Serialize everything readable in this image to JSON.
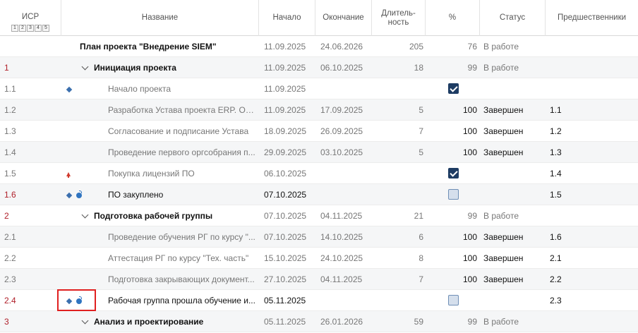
{
  "columns": {
    "wbs": "ИСР",
    "levels": [
      "1",
      "2",
      "3",
      "4",
      "5"
    ],
    "name": "Название",
    "start": "Начало",
    "end": "Окончание",
    "duration": "Длитель-\nность",
    "percent": "%",
    "status": "Статус",
    "predecessors": "Предшественники"
  },
  "rows": [
    {
      "wbs": "",
      "name": "План проекта \"Внедрение SIEM\"",
      "start": "11.09.2025",
      "end": "24.06.2026",
      "duration": "205",
      "percent": "76",
      "status": "В работе",
      "pred": ""
    },
    {
      "wbs": "1",
      "name": "Инициация проекта",
      "start": "11.09.2025",
      "end": "06.10.2025",
      "duration": "18",
      "percent": "99",
      "status": "В работе",
      "pred": ""
    },
    {
      "wbs": "1.1",
      "name": "Начало проекта",
      "start": "11.09.2025",
      "end": "",
      "duration": "",
      "percent": "",
      "checkbox": "checked",
      "status": "",
      "pred": ""
    },
    {
      "wbs": "1.2",
      "name": "Разработка Устава проекта ERP. Опр...",
      "start": "11.09.2025",
      "end": "17.09.2025",
      "duration": "5",
      "percent": "100",
      "status": "Завершен",
      "pred": "1.1"
    },
    {
      "wbs": "1.3",
      "name": "Согласование и подписание Устава",
      "start": "18.09.2025",
      "end": "26.09.2025",
      "duration": "7",
      "percent": "100",
      "status": "Завершен",
      "pred": "1.2"
    },
    {
      "wbs": "1.4",
      "name": "Проведение первого оргсобрания п...",
      "start": "29.09.2025",
      "end": "03.10.2025",
      "duration": "5",
      "percent": "100",
      "status": "Завершен",
      "pred": "1.3"
    },
    {
      "wbs": "1.5",
      "name": "Покупка лицензий ПО",
      "start": "06.10.2025",
      "end": "",
      "duration": "",
      "percent": "",
      "checkbox": "checked",
      "status": "",
      "pred": "1.4"
    },
    {
      "wbs": "1.6",
      "name": "ПО закуплено",
      "start": "07.10.2025",
      "end": "",
      "duration": "",
      "percent": "",
      "checkbox": "unchecked",
      "status": "",
      "pred": "1.5"
    },
    {
      "wbs": "2",
      "name": "Подготовка рабочей группы",
      "start": "07.10.2025",
      "end": "04.11.2025",
      "duration": "21",
      "percent": "99",
      "status": "В работе",
      "pred": ""
    },
    {
      "wbs": "2.1",
      "name": "Проведение обучения РГ по курсу \"...",
      "start": "07.10.2025",
      "end": "14.10.2025",
      "duration": "6",
      "percent": "100",
      "status": "Завершен",
      "pred": "1.6"
    },
    {
      "wbs": "2.2",
      "name": "Аттестация РГ по курсу \"Тех. часть\"",
      "start": "15.10.2025",
      "end": "24.10.2025",
      "duration": "8",
      "percent": "100",
      "status": "Завершен",
      "pred": "2.1"
    },
    {
      "wbs": "2.3",
      "name": "Подготовка закрывающих документ...",
      "start": "27.10.2025",
      "end": "04.11.2025",
      "duration": "7",
      "percent": "100",
      "status": "Завершен",
      "pred": "2.2"
    },
    {
      "wbs": "2.4",
      "name": "Рабочая группа прошла обучение и...",
      "start": "05.11.2025",
      "end": "",
      "duration": "",
      "percent": "",
      "checkbox": "unchecked",
      "status": "",
      "pred": "2.3"
    },
    {
      "wbs": "3",
      "name": "Анализ и проектирование",
      "start": "05.11.2025",
      "end": "26.01.2026",
      "duration": "59",
      "percent": "99",
      "status": "В работе",
      "pred": ""
    }
  ],
  "icons": {
    "milestone": "diamond-icon",
    "priority": "arrow-up-icon",
    "risk": "grenade-icon",
    "expand": "chevron-down-icon"
  },
  "colors": {
    "accent": "#1e3c63",
    "milestone": "#3b6fae",
    "wbs_highlight": "#b0202a",
    "priority_arrow": "#d13b2e",
    "selection_box": "#e02020"
  }
}
